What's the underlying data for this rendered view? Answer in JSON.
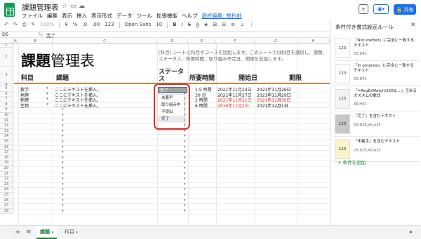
{
  "header": {
    "title": "課題管理表",
    "menu": [
      "ファイル",
      "編集",
      "表示",
      "挿入",
      "表示形式",
      "データ",
      "ツール",
      "拡張機能",
      "ヘルプ"
    ],
    "last_edit": "最終編集: 数秒前",
    "share_label": "共有"
  },
  "toolbar": {
    "zoom": "100%",
    "currency": "¥",
    "percent": "%",
    "decimals0": ".0",
    "decimals00": ".00",
    "format123": "123",
    "font": "Open Sans",
    "font_size": "10",
    "bold": "B",
    "italic": "I",
    "strike": "S",
    "text_color": "A"
  },
  "formula_bar": {
    "name_box": "D5",
    "fx": "fx",
    "value": "完了"
  },
  "columns": [
    "A",
    "B",
    "C",
    "D",
    "E",
    "F",
    "G",
    "H"
  ],
  "rows": [
    "1",
    "2",
    "3",
    "4",
    "5",
    "6",
    "7",
    "8",
    "9",
    "10",
    "11",
    "12",
    "13",
    "14",
    "15",
    "16",
    "17",
    "18",
    "19",
    "20",
    "21",
    "22",
    "23",
    "24",
    "25",
    "26",
    "27",
    "28"
  ],
  "sheet": {
    "big_title_bold": "課題",
    "big_title_rest": "管理表",
    "description": "[科目] シートに科目やコースを追加します。このシートでは科目を選択し、課題、ステータス、所要時間、取り組み予定日、期限を追加します。",
    "headers": {
      "subject": "科目",
      "task": "課題",
      "status": "ステータス",
      "time": "所要時間",
      "start": "開始日",
      "due": "期限"
    },
    "data_rows": [
      {
        "subject": "数学",
        "task": "ここにテキストを挿入。",
        "time": "1.5 時間",
        "start": "2021年11月24日",
        "due": "2021年11月26日"
      },
      {
        "subject": "地理",
        "task": "ここにテキストを挿入。",
        "time": "30 分",
        "start": "2021年11月27日",
        "due": "2021年11月29日"
      },
      {
        "subject": "物理",
        "task": "ここにテキストを挿入。",
        "time": "2 時間",
        "start": "2021年11月21日",
        "due": "2021年11月30日"
      },
      {
        "subject": "生物",
        "task": "ここにテキストを挿入。",
        "time": "6 時間",
        "start": "2016年11月2日",
        "due": "2021年12月1日"
      }
    ]
  },
  "dropdown": {
    "selected": "完了",
    "options": [
      "未着手",
      "取り組み中",
      "不提出",
      "完了"
    ]
  },
  "sheet_tabs": {
    "add": "+",
    "list": "≡",
    "tabs": [
      "課題",
      "科目"
    ]
  },
  "panel": {
    "title": "条件付き書式設定ルール",
    "rules": [
      {
        "text": "「Not started」に完全に一致するテキスト",
        "range": "D5:D41",
        "swatch": "123"
      },
      {
        "text": "「In progress」に完全に一致するテキスト",
        "range": "D5:D41",
        "swatch": "123"
      },
      {
        "text": "「=RegExMatch($D5$,...」であるカスタムの数式",
        "range": "A5:H41",
        "swatch": "123"
      },
      {
        "text": "「完了」を含むテキスト",
        "range": "D5:D25,A5:A25",
        "swatch": "123"
      },
      {
        "text": "「未着手」を含むテキスト",
        "range": "D5:D25,A5:A25",
        "swatch": "123"
      }
    ],
    "add_rule": "+ 条件を追加"
  },
  "colors": {
    "accent": "#1a73e8",
    "sheets_green": "#188038",
    "red": "#d93025",
    "rule_orange": "#c0874a"
  }
}
